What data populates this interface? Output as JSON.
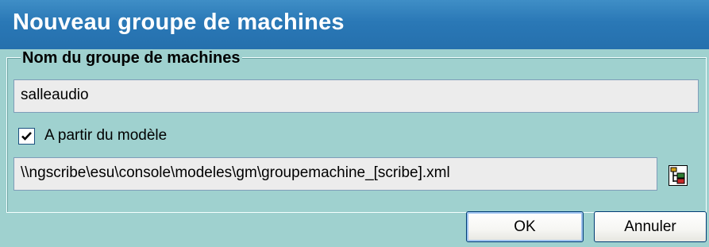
{
  "window": {
    "title": "Nouveau groupe de machines"
  },
  "group": {
    "legend": "Nom du groupe de machines",
    "name_value": "salleaudio",
    "template_checkbox": {
      "label": "A partir du modèle",
      "checked": true
    },
    "template_path": "\\\\ngscribe\\esu\\console\\modeles\\gm\\groupemachine_[scribe].xml",
    "browse_icon": "tree-browse-icon"
  },
  "buttons": {
    "ok_label": "OK",
    "cancel_label": "Annuler"
  },
  "colors": {
    "titlebar": "#2a78b6",
    "client_background": "#9fd1cf",
    "input_background": "#ececec"
  }
}
